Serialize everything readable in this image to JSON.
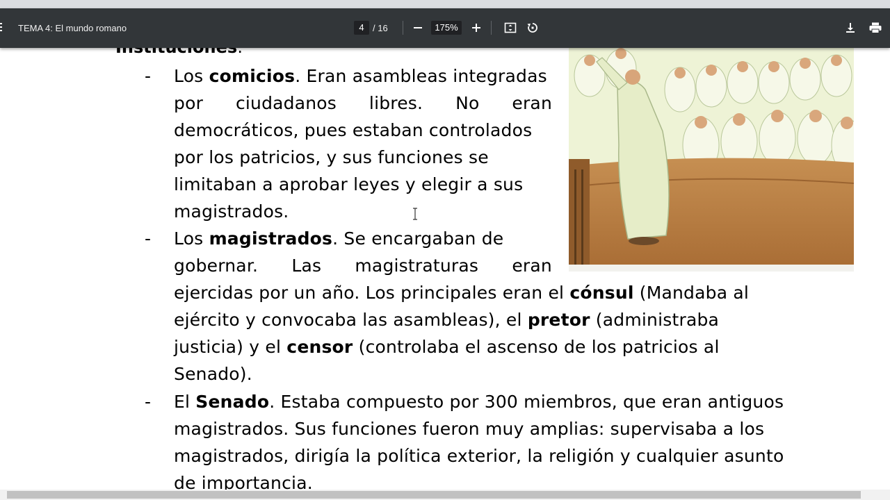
{
  "toolbar": {
    "title": "TEMA 4: El mundo romano",
    "page_current": "4",
    "page_total": "/ 16",
    "zoom": "175%"
  },
  "document": {
    "heading": "Instituciones",
    "heading_suffix": ":",
    "comicios": {
      "l1_a": "Los ",
      "l1_b": "comicios",
      "l1_c": ". Eran asambleas integradas",
      "l2": [
        "por",
        "ciudadanos",
        "libres.",
        "No",
        "eran"
      ],
      "l3": "democráticos, pues estaban controlados",
      "l4": "por los patricios, y sus funciones se",
      "l5": "limitaban a aprobar leyes y elegir a sus",
      "l6": "magistrados."
    },
    "magistrados": {
      "l1_a": "Los ",
      "l1_b": "magistrados",
      "l1_c": ". Se encargaban de",
      "l2": [
        "gobernar.",
        "Las",
        "magistraturas",
        "eran"
      ],
      "l3_a": "ejercidas por un año. Los principales eran el ",
      "l3_b": "cónsul",
      "l3_c": " (Mandaba al",
      "l4_a": "ejército y convocaba las asambleas), el ",
      "l4_b": "pretor",
      "l4_c": " (administraba",
      "l5_a": "justicia) y el ",
      "l5_b": "censor",
      "l5_c": " (controlaba el ascenso de los patricios al",
      "l6": "Senado)."
    },
    "senado": {
      "l1_a": "El ",
      "l1_b": "Senado",
      "l1_c": ". Estaba compuesto por 300 miembros, que eran antiguos",
      "l2": "magistrados. Sus funciones fueron muy amplias: supervisaba a los",
      "l3": "magistrados, dirigía la política exterior, la religión y cualquier asunto",
      "l4": "de importancia."
    },
    "dash": "-"
  },
  "colors": {
    "toolbar_bg": "#323639",
    "page_bg": "#ffffff",
    "painting_floor": "#b57a3c",
    "painting_togas": "#eef3d6"
  },
  "icons": [
    "menu-icon",
    "zoom-out-icon",
    "zoom-in-icon",
    "fit-page-icon",
    "rotate-icon",
    "download-icon",
    "print-icon"
  ]
}
